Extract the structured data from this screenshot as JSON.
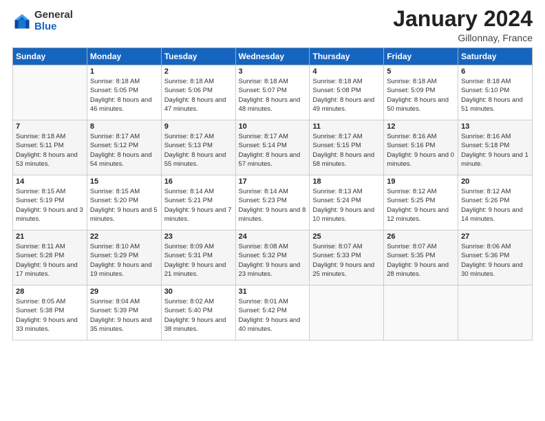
{
  "header": {
    "logo_general": "General",
    "logo_blue": "Blue",
    "month_title": "January 2024",
    "location": "Gillonnay, France"
  },
  "weekdays": [
    "Sunday",
    "Monday",
    "Tuesday",
    "Wednesday",
    "Thursday",
    "Friday",
    "Saturday"
  ],
  "rows": [
    [
      {
        "day": "",
        "sunrise": "",
        "sunset": "",
        "daylight": ""
      },
      {
        "day": "1",
        "sunrise": "Sunrise: 8:18 AM",
        "sunset": "Sunset: 5:05 PM",
        "daylight": "Daylight: 8 hours and 46 minutes."
      },
      {
        "day": "2",
        "sunrise": "Sunrise: 8:18 AM",
        "sunset": "Sunset: 5:06 PM",
        "daylight": "Daylight: 8 hours and 47 minutes."
      },
      {
        "day": "3",
        "sunrise": "Sunrise: 8:18 AM",
        "sunset": "Sunset: 5:07 PM",
        "daylight": "Daylight: 8 hours and 48 minutes."
      },
      {
        "day": "4",
        "sunrise": "Sunrise: 8:18 AM",
        "sunset": "Sunset: 5:08 PM",
        "daylight": "Daylight: 8 hours and 49 minutes."
      },
      {
        "day": "5",
        "sunrise": "Sunrise: 8:18 AM",
        "sunset": "Sunset: 5:09 PM",
        "daylight": "Daylight: 8 hours and 50 minutes."
      },
      {
        "day": "6",
        "sunrise": "Sunrise: 8:18 AM",
        "sunset": "Sunset: 5:10 PM",
        "daylight": "Daylight: 8 hours and 51 minutes."
      }
    ],
    [
      {
        "day": "7",
        "sunrise": "Sunrise: 8:18 AM",
        "sunset": "Sunset: 5:11 PM",
        "daylight": "Daylight: 8 hours and 53 minutes."
      },
      {
        "day": "8",
        "sunrise": "Sunrise: 8:17 AM",
        "sunset": "Sunset: 5:12 PM",
        "daylight": "Daylight: 8 hours and 54 minutes."
      },
      {
        "day": "9",
        "sunrise": "Sunrise: 8:17 AM",
        "sunset": "Sunset: 5:13 PM",
        "daylight": "Daylight: 8 hours and 55 minutes."
      },
      {
        "day": "10",
        "sunrise": "Sunrise: 8:17 AM",
        "sunset": "Sunset: 5:14 PM",
        "daylight": "Daylight: 8 hours and 57 minutes."
      },
      {
        "day": "11",
        "sunrise": "Sunrise: 8:17 AM",
        "sunset": "Sunset: 5:15 PM",
        "daylight": "Daylight: 8 hours and 58 minutes."
      },
      {
        "day": "12",
        "sunrise": "Sunrise: 8:16 AM",
        "sunset": "Sunset: 5:16 PM",
        "daylight": "Daylight: 9 hours and 0 minutes."
      },
      {
        "day": "13",
        "sunrise": "Sunrise: 8:16 AM",
        "sunset": "Sunset: 5:18 PM",
        "daylight": "Daylight: 9 hours and 1 minute."
      }
    ],
    [
      {
        "day": "14",
        "sunrise": "Sunrise: 8:15 AM",
        "sunset": "Sunset: 5:19 PM",
        "daylight": "Daylight: 9 hours and 3 minutes."
      },
      {
        "day": "15",
        "sunrise": "Sunrise: 8:15 AM",
        "sunset": "Sunset: 5:20 PM",
        "daylight": "Daylight: 9 hours and 5 minutes."
      },
      {
        "day": "16",
        "sunrise": "Sunrise: 8:14 AM",
        "sunset": "Sunset: 5:21 PM",
        "daylight": "Daylight: 9 hours and 7 minutes."
      },
      {
        "day": "17",
        "sunrise": "Sunrise: 8:14 AM",
        "sunset": "Sunset: 5:23 PM",
        "daylight": "Daylight: 9 hours and 8 minutes."
      },
      {
        "day": "18",
        "sunrise": "Sunrise: 8:13 AM",
        "sunset": "Sunset: 5:24 PM",
        "daylight": "Daylight: 9 hours and 10 minutes."
      },
      {
        "day": "19",
        "sunrise": "Sunrise: 8:12 AM",
        "sunset": "Sunset: 5:25 PM",
        "daylight": "Daylight: 9 hours and 12 minutes."
      },
      {
        "day": "20",
        "sunrise": "Sunrise: 8:12 AM",
        "sunset": "Sunset: 5:26 PM",
        "daylight": "Daylight: 9 hours and 14 minutes."
      }
    ],
    [
      {
        "day": "21",
        "sunrise": "Sunrise: 8:11 AM",
        "sunset": "Sunset: 5:28 PM",
        "daylight": "Daylight: 9 hours and 17 minutes."
      },
      {
        "day": "22",
        "sunrise": "Sunrise: 8:10 AM",
        "sunset": "Sunset: 5:29 PM",
        "daylight": "Daylight: 9 hours and 19 minutes."
      },
      {
        "day": "23",
        "sunrise": "Sunrise: 8:09 AM",
        "sunset": "Sunset: 5:31 PM",
        "daylight": "Daylight: 9 hours and 21 minutes."
      },
      {
        "day": "24",
        "sunrise": "Sunrise: 8:08 AM",
        "sunset": "Sunset: 5:32 PM",
        "daylight": "Daylight: 9 hours and 23 minutes."
      },
      {
        "day": "25",
        "sunrise": "Sunrise: 8:07 AM",
        "sunset": "Sunset: 5:33 PM",
        "daylight": "Daylight: 9 hours and 25 minutes."
      },
      {
        "day": "26",
        "sunrise": "Sunrise: 8:07 AM",
        "sunset": "Sunset: 5:35 PM",
        "daylight": "Daylight: 9 hours and 28 minutes."
      },
      {
        "day": "27",
        "sunrise": "Sunrise: 8:06 AM",
        "sunset": "Sunset: 5:36 PM",
        "daylight": "Daylight: 9 hours and 30 minutes."
      }
    ],
    [
      {
        "day": "28",
        "sunrise": "Sunrise: 8:05 AM",
        "sunset": "Sunset: 5:38 PM",
        "daylight": "Daylight: 9 hours and 33 minutes."
      },
      {
        "day": "29",
        "sunrise": "Sunrise: 8:04 AM",
        "sunset": "Sunset: 5:39 PM",
        "daylight": "Daylight: 9 hours and 35 minutes."
      },
      {
        "day": "30",
        "sunrise": "Sunrise: 8:02 AM",
        "sunset": "Sunset: 5:40 PM",
        "daylight": "Daylight: 9 hours and 38 minutes."
      },
      {
        "day": "31",
        "sunrise": "Sunrise: 8:01 AM",
        "sunset": "Sunset: 5:42 PM",
        "daylight": "Daylight: 9 hours and 40 minutes."
      },
      {
        "day": "",
        "sunrise": "",
        "sunset": "",
        "daylight": ""
      },
      {
        "day": "",
        "sunrise": "",
        "sunset": "",
        "daylight": ""
      },
      {
        "day": "",
        "sunrise": "",
        "sunset": "",
        "daylight": ""
      }
    ]
  ]
}
